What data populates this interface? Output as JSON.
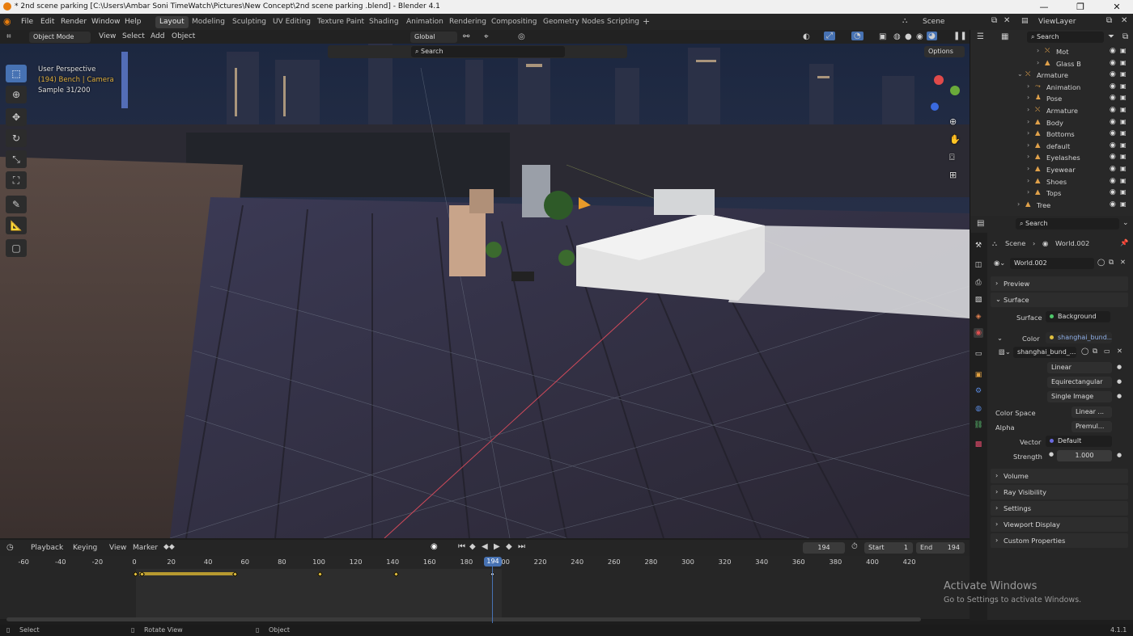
{
  "window": {
    "title": "* 2nd scene parking  [C:\\Users\\Ambar Soni TimeWatch\\Pictures\\New Concept\\2nd scene parking .blend] - Blender 4.1",
    "minimize": "—",
    "maximize": "❐",
    "close": "✕"
  },
  "menus": [
    "File",
    "Edit",
    "Render",
    "Window",
    "Help"
  ],
  "workspaces": [
    "Layout",
    "Modeling",
    "Sculpting",
    "UV Editing",
    "Texture Paint",
    "Shading",
    "Animation",
    "Rendering",
    "Compositing",
    "Geometry Nodes",
    "Scripting"
  ],
  "active_workspace": "Layout",
  "add_workspace": "+",
  "scene": {
    "label": "Scene",
    "viewlayer": "ViewLayer"
  },
  "viewport_header": {
    "mode": "Object Mode",
    "menus": [
      "View",
      "Select",
      "Add",
      "Object"
    ],
    "orientation": "Global",
    "search_placeholder": "Search",
    "options": "Options"
  },
  "viewport_overlay": {
    "line1": "User Perspective",
    "line2": "(194) Bench | Camera",
    "line3": "Sample 31/200"
  },
  "outliner": {
    "search_placeholder": "Search",
    "items": [
      {
        "label": "Mot",
        "indent": 2,
        "icon": "armature"
      },
      {
        "label": "Glass B",
        "indent": 2,
        "icon": "mesh"
      },
      {
        "label": "Armature",
        "indent": 0,
        "icon": "armature",
        "expanded": true
      },
      {
        "label": "Animation",
        "indent": 1,
        "icon": "action"
      },
      {
        "label": "Pose",
        "indent": 1,
        "icon": "pose"
      },
      {
        "label": "Armature",
        "indent": 1,
        "icon": "armature"
      },
      {
        "label": "Body",
        "indent": 1,
        "icon": "mesh"
      },
      {
        "label": "Bottoms",
        "indent": 1,
        "icon": "mesh"
      },
      {
        "label": "default",
        "indent": 1,
        "icon": "mesh"
      },
      {
        "label": "Eyelashes",
        "indent": 1,
        "icon": "mesh"
      },
      {
        "label": "Eyewear",
        "indent": 1,
        "icon": "mesh"
      },
      {
        "label": "Shoes",
        "indent": 1,
        "icon": "mesh"
      },
      {
        "label": "Tops",
        "indent": 1,
        "icon": "mesh"
      },
      {
        "label": "Tree",
        "indent": 0,
        "icon": "mesh"
      }
    ]
  },
  "properties": {
    "search_placeholder": "Search",
    "breadcrumb_scene": "Scene",
    "breadcrumb_world": "World.002",
    "world_name": "World.002",
    "panels_top": [
      "Preview",
      "Surface"
    ],
    "surface": {
      "label": "Surface",
      "value": "Background"
    },
    "color": {
      "label": "Color",
      "value": "shanghai_bund..."
    },
    "image": {
      "value": "shanghai_bund_..."
    },
    "interpolation": "Linear",
    "projection": "Equirectangular",
    "source": "Single Image",
    "color_space": {
      "label": "Color Space",
      "value": "Linear ..."
    },
    "alpha": {
      "label": "Alpha",
      "value": "Premul..."
    },
    "vector": {
      "label": "Vector",
      "value": "Default"
    },
    "strength": {
      "label": "Strength",
      "value": "1.000"
    },
    "panels_bottom": [
      "Volume",
      "Ray Visibility",
      "Settings",
      "Viewport Display",
      "Custom Properties"
    ]
  },
  "timeline": {
    "menus": [
      "Playback",
      "Keying",
      "View",
      "Marker"
    ],
    "current_frame": "194",
    "start_label": "Start",
    "start": "1",
    "end_label": "End",
    "end": "194",
    "ticks": [
      "-60",
      "-40",
      "-20",
      "0",
      "20",
      "40",
      "60",
      "80",
      "100",
      "120",
      "140",
      "160",
      "180",
      "200",
      "220",
      "240",
      "260",
      "280",
      "300",
      "320",
      "340",
      "360",
      "380",
      "400",
      "420"
    ],
    "playhead_label": "194"
  },
  "status": {
    "select": "Select",
    "rotate": "Rotate View",
    "object": "Object",
    "version": "4.1.1"
  },
  "watermark": {
    "line1": "Activate Windows",
    "line2": "Go to Settings to activate Windows."
  }
}
